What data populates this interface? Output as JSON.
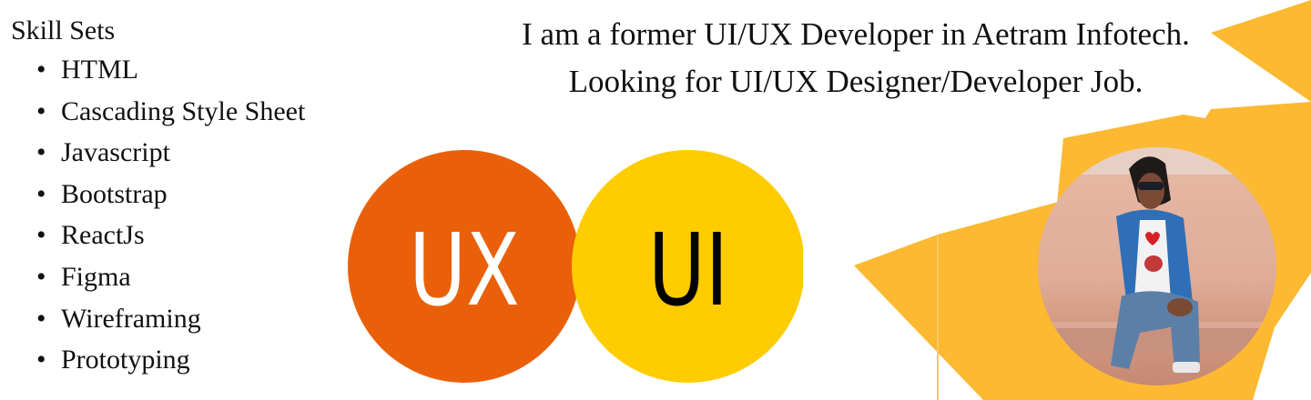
{
  "skills": {
    "title": "Skill Sets",
    "bullet": "•",
    "items": [
      "HTML",
      "Cascading Style Sheet",
      "Javascript",
      "Bootstrap",
      "ReactJs",
      "Figma",
      "Wireframing",
      "Prototyping"
    ]
  },
  "intro": {
    "line1": "I am a former UI/UX Developer in Aetram Infotech.",
    "line2": "Looking for UI/UX Designer/Developer Job."
  },
  "logo": {
    "left_text": "UX",
    "right_text": "UI",
    "left_color": "#EA600A",
    "right_color": "#FFCC00"
  },
  "accent_color": "#FCB931"
}
